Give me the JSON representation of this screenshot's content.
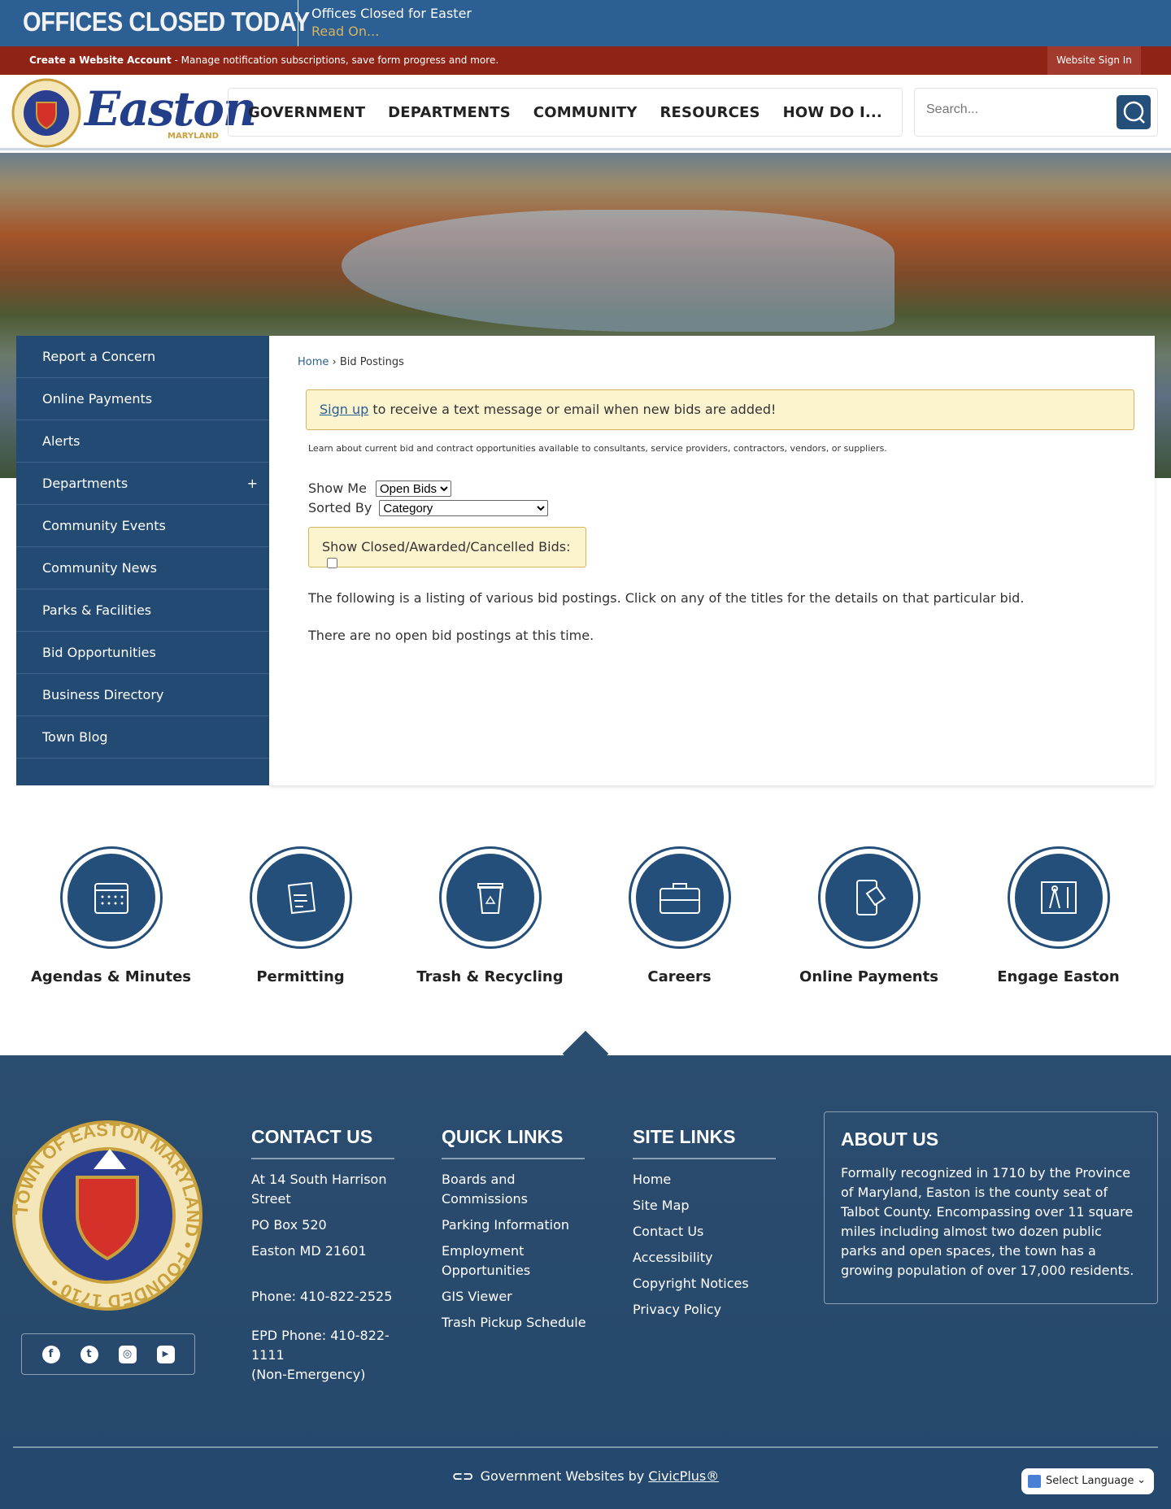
{
  "alert": {
    "title": "OFFICES CLOSED TODAY",
    "message": "Offices Closed for Easter",
    "link": "Read On..."
  },
  "account_bar": {
    "create": "Create a Website Account",
    "description": " - Manage notification subscriptions, save form progress and more.",
    "sign_in": "Website Sign In"
  },
  "logo": {
    "word": "Easton",
    "state": "MARYLAND"
  },
  "nav": [
    "GOVERNMENT",
    "DEPARTMENTS",
    "COMMUNITY",
    "RESOURCES",
    "HOW DO I..."
  ],
  "search": {
    "placeholder": "Search..."
  },
  "sidebar": [
    {
      "label": "Report a Concern"
    },
    {
      "label": "Online Payments"
    },
    {
      "label": "Alerts"
    },
    {
      "label": "Departments",
      "expand": "+"
    },
    {
      "label": "Community Events"
    },
    {
      "label": "Community News"
    },
    {
      "label": "Parks & Facilities"
    },
    {
      "label": "Bid Opportunities"
    },
    {
      "label": "Business Directory"
    },
    {
      "label": "Town Blog"
    }
  ],
  "breadcrumb": {
    "home": "Home",
    "sep": " › ",
    "current": "Bid Postings"
  },
  "main": {
    "signup_link": "Sign up",
    "signup_text": " to receive a text message or email when new bids are added!",
    "learn": "Learn about current bid and contract opportunities available to consultants, service providers, contractors, vendors, or suppliers.",
    "show_me_label": "Show Me",
    "show_me_value": "Open Bids",
    "sorted_by_label": "Sorted By",
    "sorted_by_value": "Category",
    "closed_label": "Show Closed/Awarded/Cancelled Bids:",
    "listing": "The following is a listing of various bid postings. Click on any of the titles for the details on that particular bid.",
    "none": "There are no open bid postings at this time."
  },
  "quick_icons": [
    {
      "label": "Agendas & Minutes",
      "icon": "calendar-icon"
    },
    {
      "label": "Permitting",
      "icon": "permit-icon"
    },
    {
      "label": "Trash & Recycling",
      "icon": "recycle-bin-icon"
    },
    {
      "label": "Careers",
      "icon": "briefcase-icon"
    },
    {
      "label": "Online Payments",
      "icon": "phone-payment-icon"
    },
    {
      "label": "Engage Easton",
      "icon": "blueprint-icon"
    }
  ],
  "footer": {
    "contact": {
      "title": "CONTACT US",
      "lines": [
        "At 14 South Harrison Street",
        "PO Box 520",
        "Easton MD 21601",
        "Phone: 410-822-2525",
        "EPD Phone: 410-822-1111",
        "(Non-Emergency)"
      ]
    },
    "quick_links": {
      "title": "QUICK LINKS",
      "items": [
        "Boards and Commissions",
        "Parking Information",
        "Employment Opportunities",
        "GIS Viewer",
        "Trash Pickup Schedule"
      ]
    },
    "site_links": {
      "title": "SITE LINKS",
      "items": [
        "Home",
        "Site Map",
        "Contact Us",
        "Accessibility",
        "Copyright Notices",
        "Privacy Policy"
      ]
    },
    "about": {
      "title": "ABOUT US",
      "text": "Formally recognized in 1710 by the Province of Maryland, Easton is the county seat of Talbot County. Encompassing over 11 square miles including almost two dozen public parks and open spaces, the town has a growing population of over 17,000 residents."
    },
    "seal_text": "TOWN OF EASTON MARYLAND • FOUNDED 1710 •",
    "social": [
      "facebook",
      "twitter",
      "instagram",
      "youtube"
    ],
    "civic_prefix": "Government Websites by ",
    "civic_link": "CivicPlus®",
    "language": "Select Language"
  }
}
